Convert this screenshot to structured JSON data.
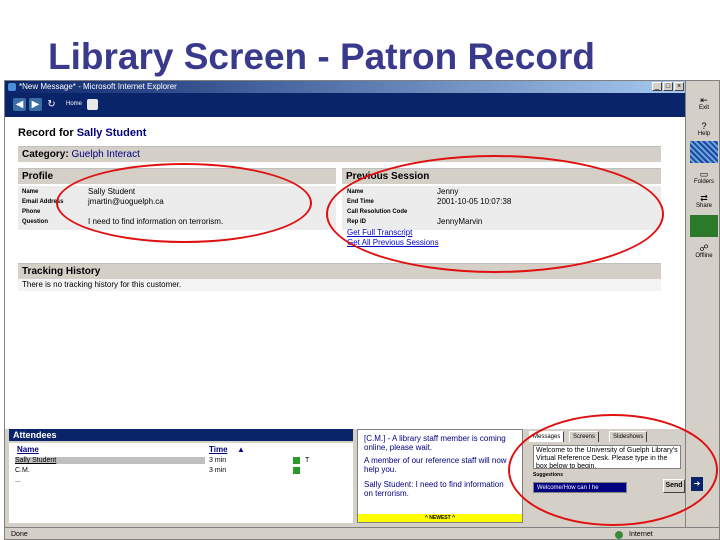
{
  "slide": {
    "title": "Library Screen - Patron Record"
  },
  "window": {
    "title": "*New Message* - Microsoft Internet Explorer",
    "nav_home_label": "Home",
    "status_left": "Done",
    "status_right": "Internet"
  },
  "record": {
    "prefix": "Record for",
    "patron_name": "Sally Student",
    "category_label": "Category:",
    "category_value": "Guelph Interact"
  },
  "profile": {
    "header": "Profile",
    "fields": [
      {
        "key": "Name",
        "value": "Sally Student"
      },
      {
        "key": "Email Address",
        "value": "jmartin@uoguelph.ca"
      },
      {
        "key": "Phone",
        "value": ""
      },
      {
        "key": "Question",
        "value": "I need to find information on terrorism."
      }
    ]
  },
  "previous_session": {
    "header": "Previous Session",
    "fields": [
      {
        "key": "Name",
        "value": "Jenny"
      },
      {
        "key": "End Time",
        "value": "2001-10-05 10:07:38"
      },
      {
        "key": "Call Resolution Code",
        "value": ""
      },
      {
        "key": "Rep ID",
        "value": "JennyMarvin"
      }
    ],
    "links": [
      "Get Full Transcript",
      "Get All Previous Sessions"
    ]
  },
  "tracking": {
    "header": "Tracking History",
    "text": "There is no tracking history for this customer."
  },
  "sidebar": {
    "items": [
      {
        "label": "Exit",
        "icon": "exit-icon"
      },
      {
        "label": "Help",
        "icon": "help-icon"
      },
      {
        "label": "Folders",
        "icon": "folders-icon"
      },
      {
        "label": "Share",
        "icon": "share-icon"
      },
      {
        "label": "Offline",
        "icon": "offline-icon"
      }
    ]
  },
  "attendees": {
    "header": "Attendees",
    "col_name": "Name",
    "col_time": "Time",
    "rows": [
      {
        "name": "Sally Student",
        "time": "3 min",
        "flag": "T"
      },
      {
        "name": "C.M.",
        "time": "3 min",
        "flag": ""
      },
      {
        "name": "...",
        "time": "",
        "flag": ""
      }
    ]
  },
  "chat": {
    "lines": [
      "[C.M.] - A library staff member is coming online, please wait.",
      "A member of our reference staff will now help you.",
      "Sally Student: I need to find information on terrorism."
    ],
    "newest_label": "^ NEWEST ^"
  },
  "message_panel": {
    "tabs": [
      "Messages",
      "Screens",
      "Slideshows"
    ],
    "welcome_text": "Welcome to the University of Guelph Library's Virtual Reference Desk. Please type in the box below to begin.",
    "suggestions_label": "Suggestions",
    "suggestion_value": "Welcome/How can I he",
    "send_label": "Send"
  },
  "colors": {
    "title_blue": "#3a3a8c",
    "annotation_red": "#e01010",
    "navy": "#0a246a"
  }
}
